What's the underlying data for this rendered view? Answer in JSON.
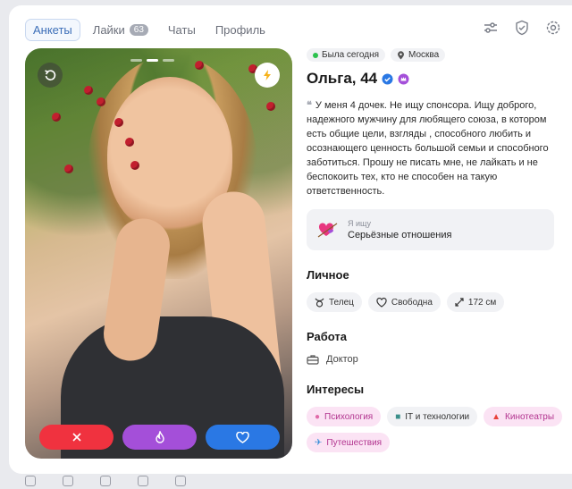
{
  "nav": {
    "tabs": [
      {
        "label": "Анкеты"
      },
      {
        "label": "Лайки",
        "badge": "63"
      },
      {
        "label": "Чаты"
      },
      {
        "label": "Профиль"
      }
    ],
    "icons": [
      "filters-icon",
      "shield-icon",
      "settings-icon"
    ]
  },
  "profile": {
    "status": "Была сегодня",
    "city": "Москва",
    "name_age": "Ольга, 44",
    "bio": "У меня 4 дочек. Не ищу спонсора. Ищу доброго, надежного мужчину для любящего союза, в котором есть общие цели, взгляды , способного любить и осознающего ценность большой семьи и способного заботиться. Прошу не писать мне, не лайкать и не беспокоить тех, кто не способен на такую ответственность.",
    "seeking_label": "Я ищу",
    "seeking_value": "Серьёзные отношения",
    "personal_title": "Личное",
    "personal": [
      {
        "icon": "taurus-icon",
        "label": "Телец"
      },
      {
        "icon": "heart-outline-icon",
        "label": "Свободна"
      },
      {
        "icon": "height-icon",
        "label": "172 см"
      }
    ],
    "work_title": "Работа",
    "work": "Доктор",
    "interests_title": "Интересы",
    "interests": [
      {
        "icon": "brain-icon",
        "label": "Психология",
        "pink": true
      },
      {
        "icon": "robot-icon",
        "label": "IT и технологии",
        "pink": false
      },
      {
        "icon": "popcorn-icon",
        "label": "Кинотеатры",
        "pink": true
      },
      {
        "icon": "airplane-icon",
        "label": "Путешествия",
        "pink": true
      }
    ]
  },
  "photo": {
    "pages_total": 3,
    "current_page": 2
  }
}
